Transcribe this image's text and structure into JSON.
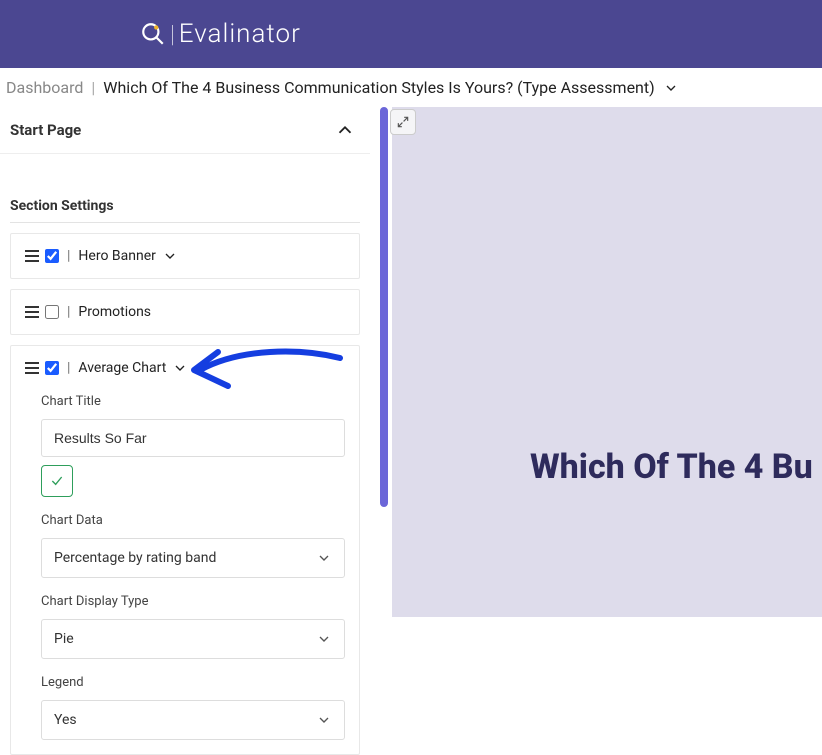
{
  "brand": {
    "name": "Evalinator"
  },
  "breadcrumb": {
    "dashboard": "Dashboard",
    "title": "Which Of The 4 Business Communication Styles Is Yours? (Type Assessment)"
  },
  "left_panel": {
    "accordion_title": "Start Page",
    "section_label": "Section Settings",
    "items": [
      {
        "checked": true,
        "label": "Hero Banner",
        "expandable": true
      },
      {
        "checked": false,
        "label": "Promotions",
        "expandable": false
      },
      {
        "checked": true,
        "label": "Average Chart",
        "expandable": true
      }
    ],
    "average_chart_form": {
      "chart_title_label": "Chart Title",
      "chart_title_value": "Results So Far",
      "chart_data_label": "Chart Data",
      "chart_data_value": "Percentage by rating band",
      "chart_display_label": "Chart Display Type",
      "chart_display_value": "Pie",
      "legend_label": "Legend",
      "legend_value": "Yes"
    }
  },
  "preview": {
    "heading": "Which Of The 4 Bu"
  }
}
